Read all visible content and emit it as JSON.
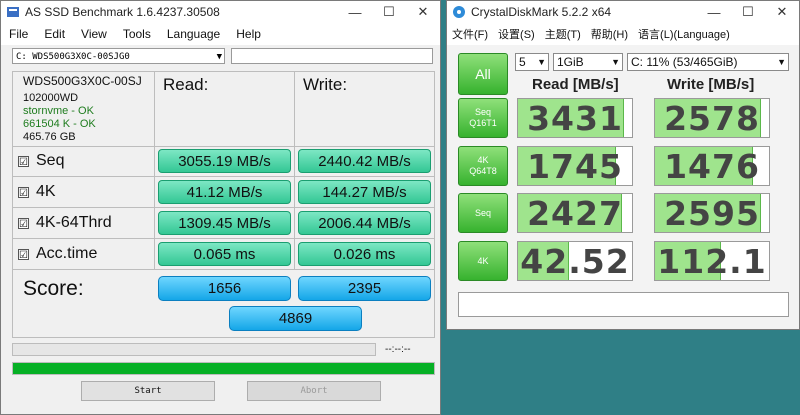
{
  "asssd": {
    "title": "AS SSD Benchmark 1.6.4237.30508",
    "menu": [
      "File",
      "Edit",
      "View",
      "Tools",
      "Language",
      "Help"
    ],
    "drive_select": "C: WDS500G3X0C-00SJG0",
    "info": {
      "model": "WDS500G3X0C-00SJ",
      "firmware": "102000WD",
      "driver": "stornvme - OK",
      "alignment": "661504 K - OK",
      "size": "465.76 GB"
    },
    "headers": {
      "read": "Read:",
      "write": "Write:"
    },
    "rows": [
      {
        "label": "Seq",
        "checked": true,
        "read": "3055.19 MB/s",
        "write": "2440.42 MB/s"
      },
      {
        "label": "4K",
        "checked": true,
        "read": "41.12 MB/s",
        "write": "144.27 MB/s"
      },
      {
        "label": "4K-64Thrd",
        "checked": true,
        "read": "1309.45 MB/s",
        "write": "2006.44 MB/s"
      },
      {
        "label": "Acc.time",
        "checked": true,
        "read": "0.065 ms",
        "write": "0.026 ms"
      }
    ],
    "check_mark": "☑",
    "score_label": "Score:",
    "score": {
      "read": "1656",
      "write": "2395",
      "total": "4869"
    },
    "timer": "--:--:--",
    "progress": 1.0,
    "buttons": {
      "start": "Start",
      "abort": "Abort"
    }
  },
  "cdm": {
    "title": "CrystalDiskMark 5.2.2 x64",
    "menu": [
      "文件(F)",
      "设置(S)",
      "主题(T)",
      "帮助(H)",
      "语言(L)(Language)"
    ],
    "all_label": "All",
    "count_select": "5",
    "size_select": "1GiB",
    "drive_select": "C: 11% (53/465GiB)",
    "headers": {
      "read": "Read [MB/s]",
      "write": "Write [MB/s]"
    },
    "rows": [
      {
        "line1": "Seq",
        "line2": "Q16T1",
        "read": "3431",
        "write": "2578",
        "read_fill": 0.92,
        "write_fill": 0.92
      },
      {
        "line1": "4K",
        "line2": "Q64T8",
        "read": "1745",
        "write": "1476",
        "read_fill": 0.85,
        "write_fill": 0.85
      },
      {
        "line1": "Seq",
        "line2": "",
        "read": "2427",
        "write": "2595",
        "read_fill": 0.9,
        "write_fill": 0.92
      },
      {
        "line1": "4K",
        "line2": "",
        "read": "42.52",
        "write": "112.1",
        "read_fill": 0.44,
        "write_fill": 0.57
      }
    ]
  }
}
